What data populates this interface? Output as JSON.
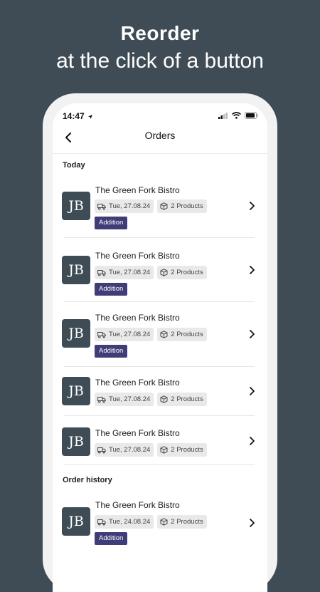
{
  "headline": {
    "line1": "Reorder",
    "line2": "at the click of a button"
  },
  "status": {
    "time": "14:47"
  },
  "nav": {
    "title": "Orders"
  },
  "sections": {
    "today": "Today",
    "history": "Order history"
  },
  "orders": [
    {
      "initials": "JB",
      "name": "The Green Fork Bistro",
      "date": "Tue, 27.08.24",
      "products": "2 Products",
      "badge": "Addition"
    },
    {
      "initials": "JB",
      "name": "The Green Fork Bistro",
      "date": "Tue, 27.08.24",
      "products": "2 Products",
      "badge": "Addition"
    },
    {
      "initials": "JB",
      "name": "The Green Fork Bistro",
      "date": "Tue, 27.08.24",
      "products": "2 Products",
      "badge": "Addition"
    },
    {
      "initials": "JB",
      "name": "The Green Fork Bistro",
      "date": "Tue, 27.08.24",
      "products": "2 Products"
    },
    {
      "initials": "JB",
      "name": "The Green Fork Bistro",
      "date": "Tue, 27.08.24",
      "products": "2 Products"
    },
    {
      "initials": "JB",
      "name": "The Green Fork Bistro",
      "date": "Tue, 24.08.24",
      "products": "2 Products",
      "badge": "Addition"
    }
  ],
  "colors": {
    "background": "#3f4c55",
    "avatar": "#3e4c55",
    "badge": "#3f3c78",
    "chip": "#e9e9e9"
  }
}
